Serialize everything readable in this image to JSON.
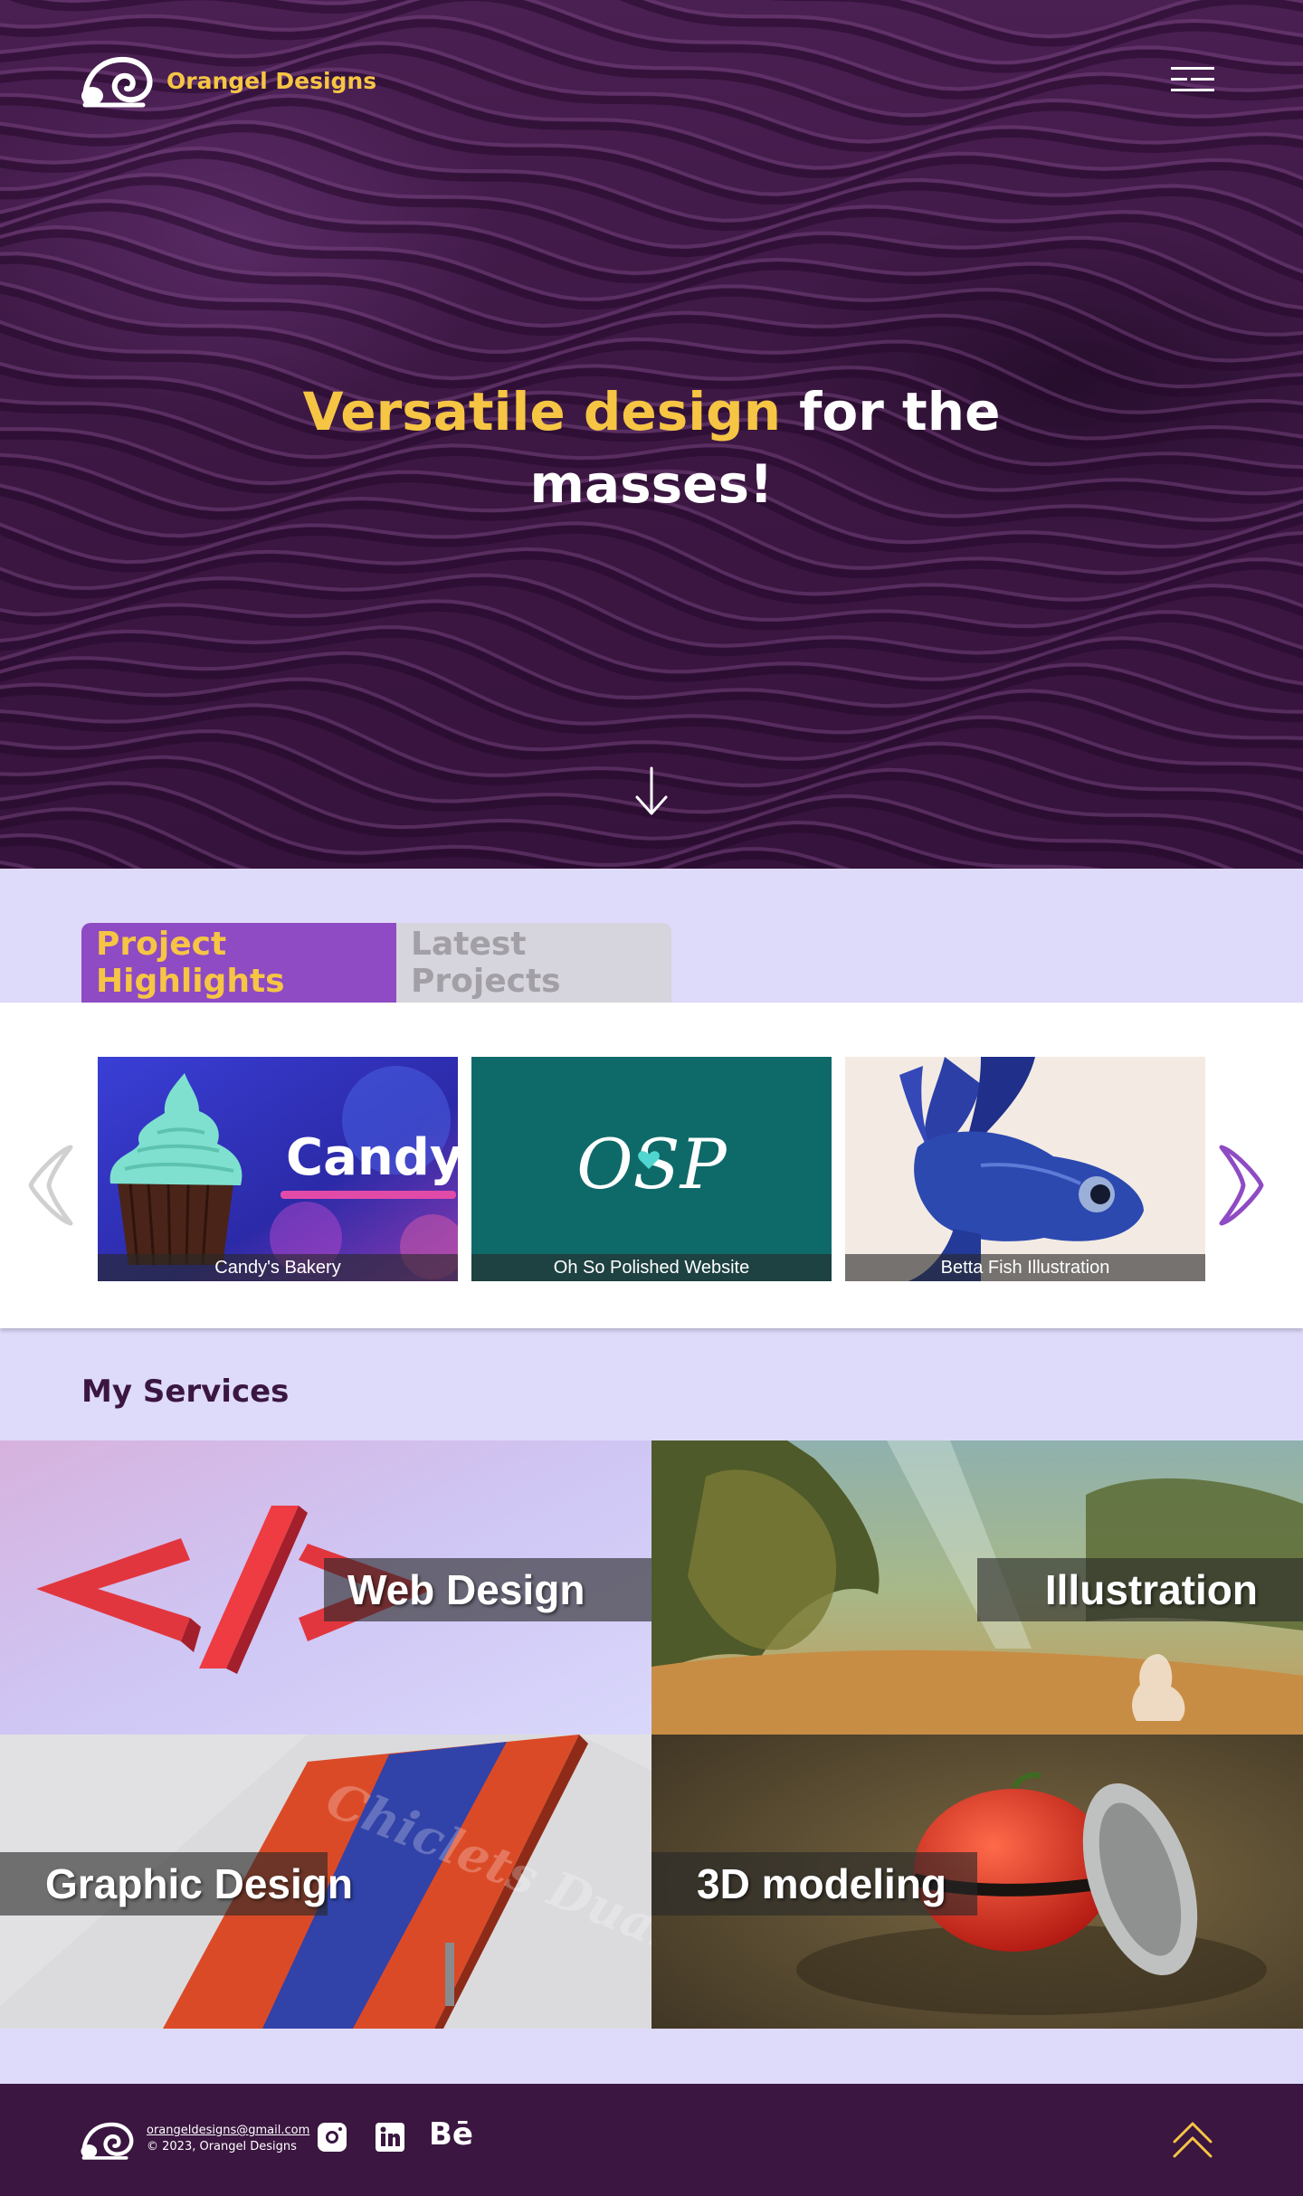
{
  "brand": {
    "name": "Orangel Designs",
    "accent": "#f6c544",
    "purple": "#8f4bc3",
    "dark": "#3a1640"
  },
  "header": {
    "logo_icon": "snail-spiral-icon",
    "menu_icon": "hamburger-menu-icon"
  },
  "hero": {
    "headline_highlight": "Versatile design",
    "headline_rest": " for the masses!",
    "scroll_icon": "arrow-down-icon"
  },
  "projects": {
    "tabs": [
      {
        "label": "Project Highlights",
        "active": true
      },
      {
        "label": "Latest Projects",
        "active": false
      }
    ],
    "prev_icon": "chevron-left-icon",
    "next_icon": "chevron-right-icon",
    "cards": [
      {
        "caption": "Candy's Bakery",
        "image_text": "Candy"
      },
      {
        "caption": "Oh So Polished Website",
        "image_text": "OSP"
      },
      {
        "caption": "Betta Fish Illustration"
      }
    ]
  },
  "services": {
    "title": "My Services",
    "items": [
      {
        "label": "Web Design"
      },
      {
        "label": "Illustration"
      },
      {
        "label": "Graphic Design",
        "image_text": "Chiclets Dual"
      },
      {
        "label": "3D modeling"
      }
    ]
  },
  "footer": {
    "email": "orangeldesigns@gmail.com",
    "copyright": "© 2023, Orangel Designs",
    "social": [
      "instagram-icon",
      "linkedin-icon",
      "behance-icon"
    ],
    "behance_text": "Bē",
    "top_icon": "double-chevron-up-icon"
  }
}
